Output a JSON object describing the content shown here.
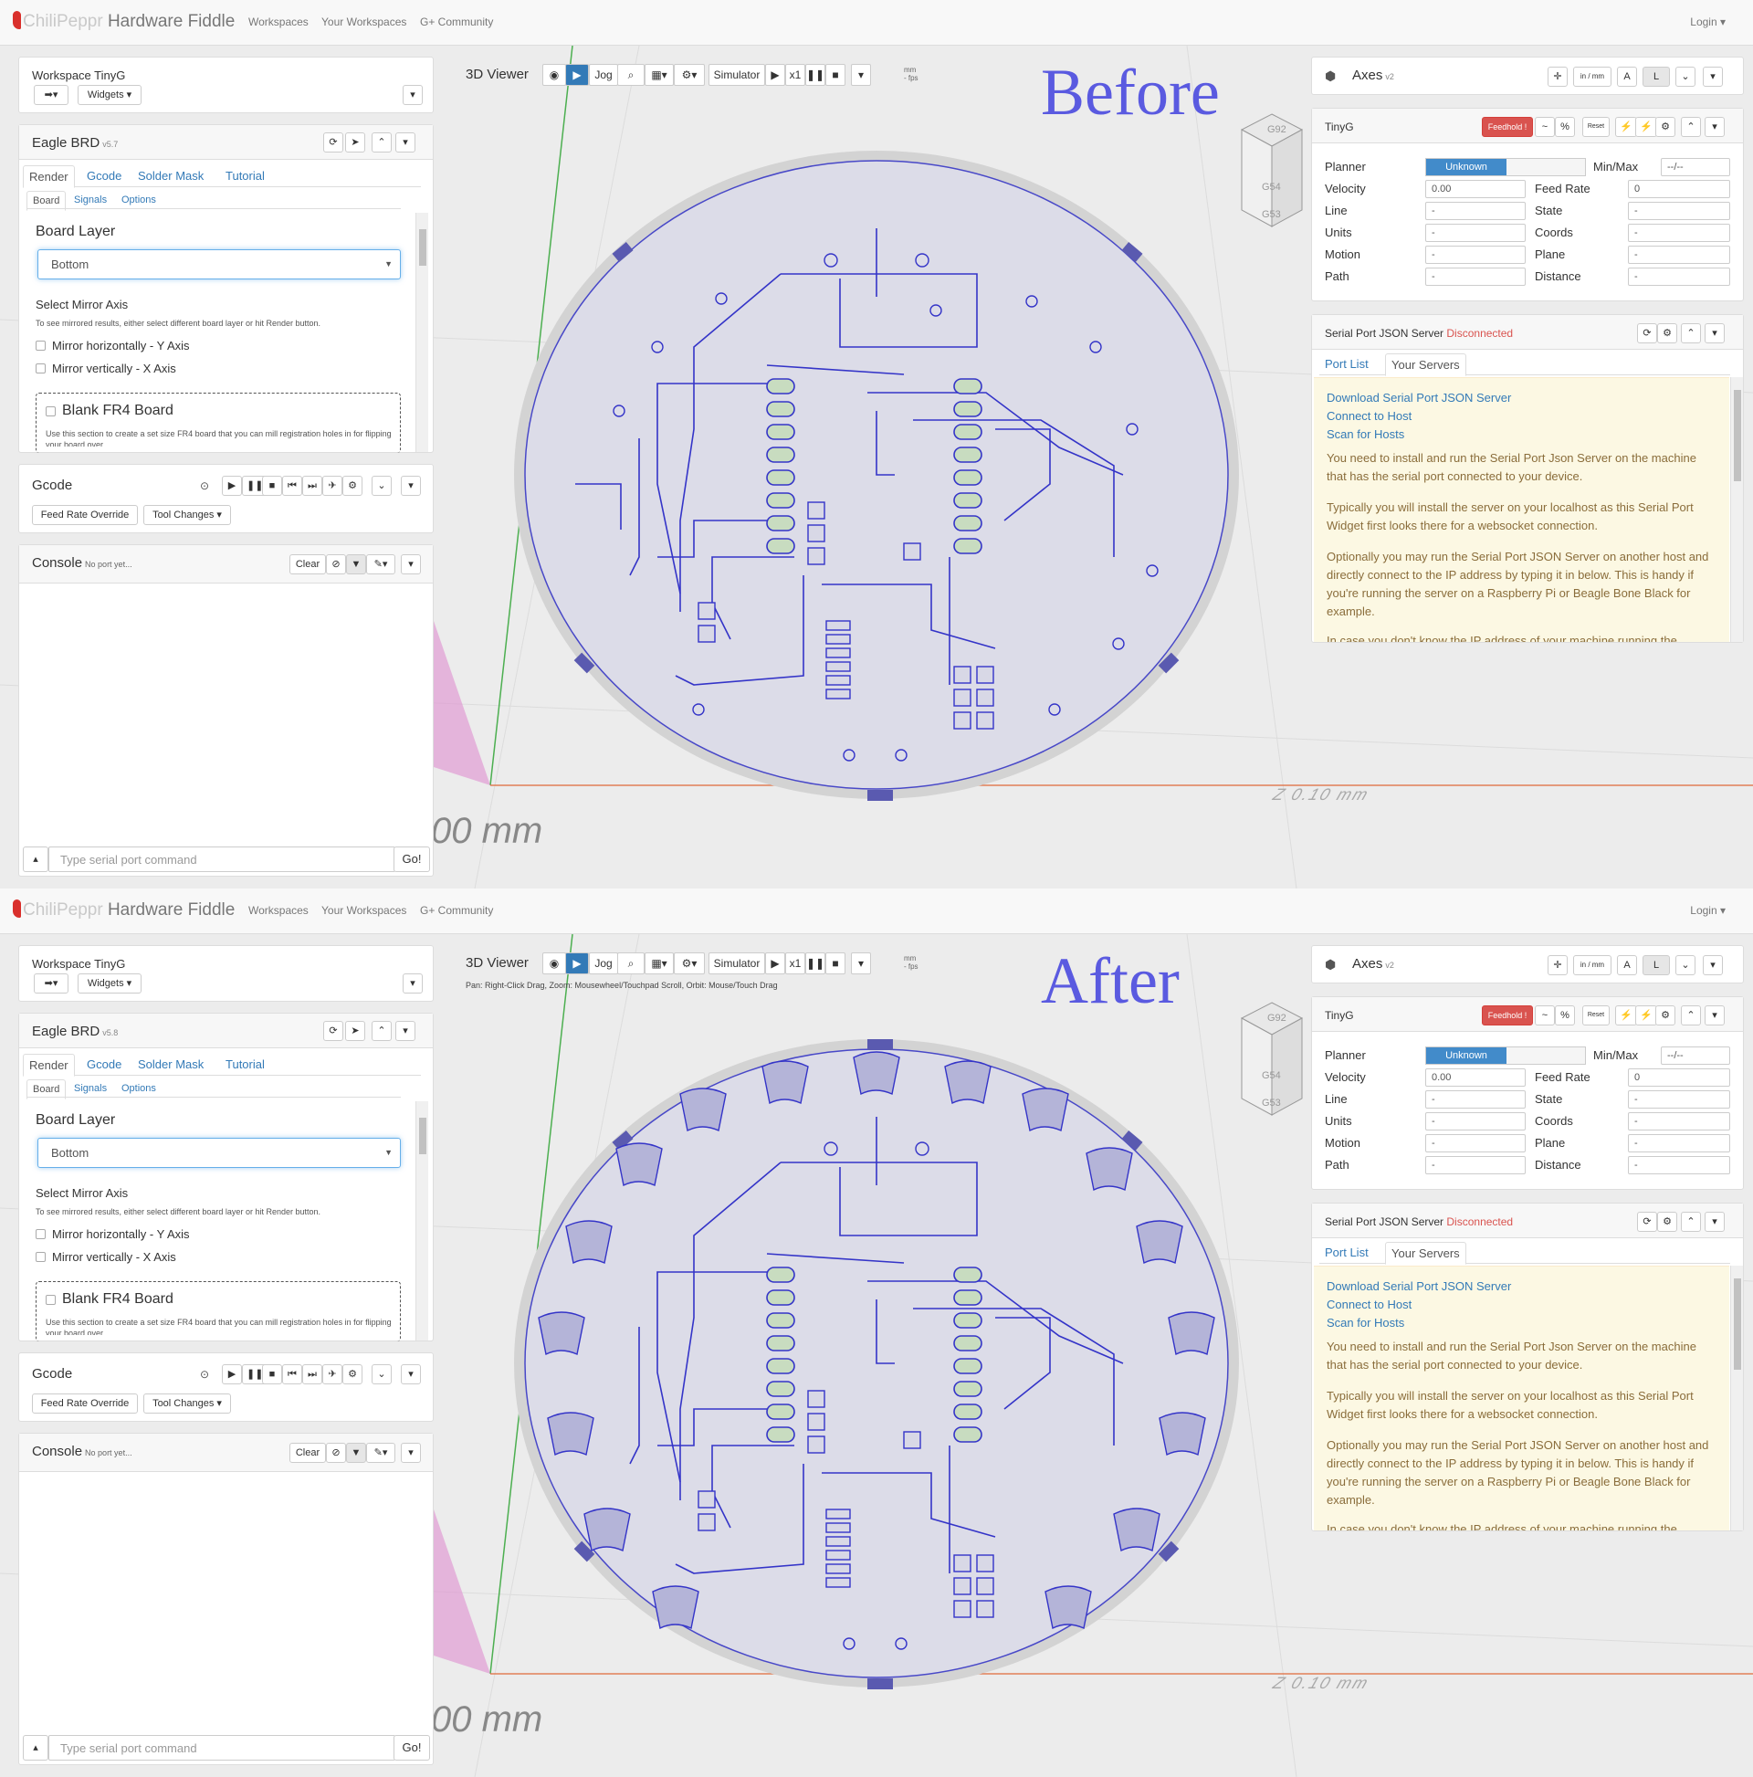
{
  "nav": {
    "brand_a": "ChiliPeppr",
    "brand_b": "Hardware Fiddle",
    "links": [
      "Workspaces",
      "Your Workspaces",
      "G+ Community"
    ],
    "login": "Login"
  },
  "workspace": {
    "title": "Workspace TinyG",
    "widgets_btn": "Widgets"
  },
  "eagle": {
    "title": "Eagle BRD",
    "version_before": "v5.7",
    "version_after": "v5.8",
    "tabs": [
      "Render",
      "Gcode",
      "Solder Mask",
      "Tutorial"
    ],
    "subtabs": [
      "Board",
      "Signals",
      "Options"
    ],
    "board_layer_label": "Board Layer",
    "board_layer_value": "Bottom",
    "mirror_title": "Select Mirror Axis",
    "mirror_hint": "To see mirrored results, either select different board layer or hit Render button.",
    "mirror_h": "Mirror horizontally - Y Axis",
    "mirror_v": "Mirror vertically - X Axis",
    "blank_title": "Blank FR4 Board",
    "blank_hint": "Use this section to create a set size FR4 board that you can mill registration holes in for flipping your board over."
  },
  "gcode": {
    "title": "Gcode",
    "feed_override": "Feed Rate Override",
    "tool_changes": "Tool Changes"
  },
  "console": {
    "title": "Console",
    "status": "No port yet...",
    "clear": "Clear",
    "placeholder": "Type serial port command",
    "go": "Go!"
  },
  "viewer": {
    "title": "3D Viewer",
    "jog": "Jog",
    "simulator": "Simulator",
    "speed": "x1",
    "units_line1": "mm",
    "units_line2": "- fps",
    "hint": "Pan: Right-Click Drag, Zoom: Mousewheel/Touchpad Scroll, Orbit: Mouse/Touch Drag",
    "scale_label": "00 mm",
    "z_label": "Z 0.10 mm",
    "before_label": "Before",
    "after_label": "After",
    "cube_labels": [
      "G92",
      "G54",
      "G53"
    ]
  },
  "axes": {
    "title": "Axes",
    "version": "v2",
    "units_btn": "in / mm"
  },
  "tinyg": {
    "title": "TinyG",
    "feedhold": "Feedhold !",
    "reset": "Reset",
    "planner_label": "Planner",
    "planner_value": "Unknown",
    "minmax_label": "Min/Max",
    "minmax_value": "--/--",
    "rows_left": [
      {
        "label": "Velocity",
        "value": "0.00"
      },
      {
        "label": "Line",
        "value": "-"
      },
      {
        "label": "Units",
        "value": "-"
      },
      {
        "label": "Motion",
        "value": "-"
      },
      {
        "label": "Path",
        "value": "-"
      }
    ],
    "rows_right": [
      {
        "label": "Feed Rate",
        "value": "0"
      },
      {
        "label": "State",
        "value": "-"
      },
      {
        "label": "Coords",
        "value": "-"
      },
      {
        "label": "Plane",
        "value": "-"
      },
      {
        "label": "Distance",
        "value": "-"
      }
    ]
  },
  "serial": {
    "title": "Serial Port JSON Server",
    "status": "Disconnected",
    "tabs": [
      "Port List",
      "Your Servers"
    ],
    "links": [
      "Download Serial Port JSON Server",
      "Connect to Host",
      "Scan for Hosts"
    ],
    "para1": "You need to install and run the Serial Port Json Server on the machine that has the serial port connected to your device.",
    "para2": "Typically you will install the server on your localhost as this Serial Port Widget first looks there for a websocket connection.",
    "para3": "Optionally you may run the Serial Port JSON Server on another host and directly connect to the IP address by typing it in below. This is handy if you're running the server on a Raspberry Pi or Beagle Bone Black for example.",
    "para4": "In case you don't know the IP address of your machine running the"
  },
  "colors": {
    "accent": "#337ab7",
    "feedhold": "#d9534f",
    "planner": "#428bca",
    "label_blue": "#5a5ae0",
    "disconnected": "#d9534f"
  }
}
